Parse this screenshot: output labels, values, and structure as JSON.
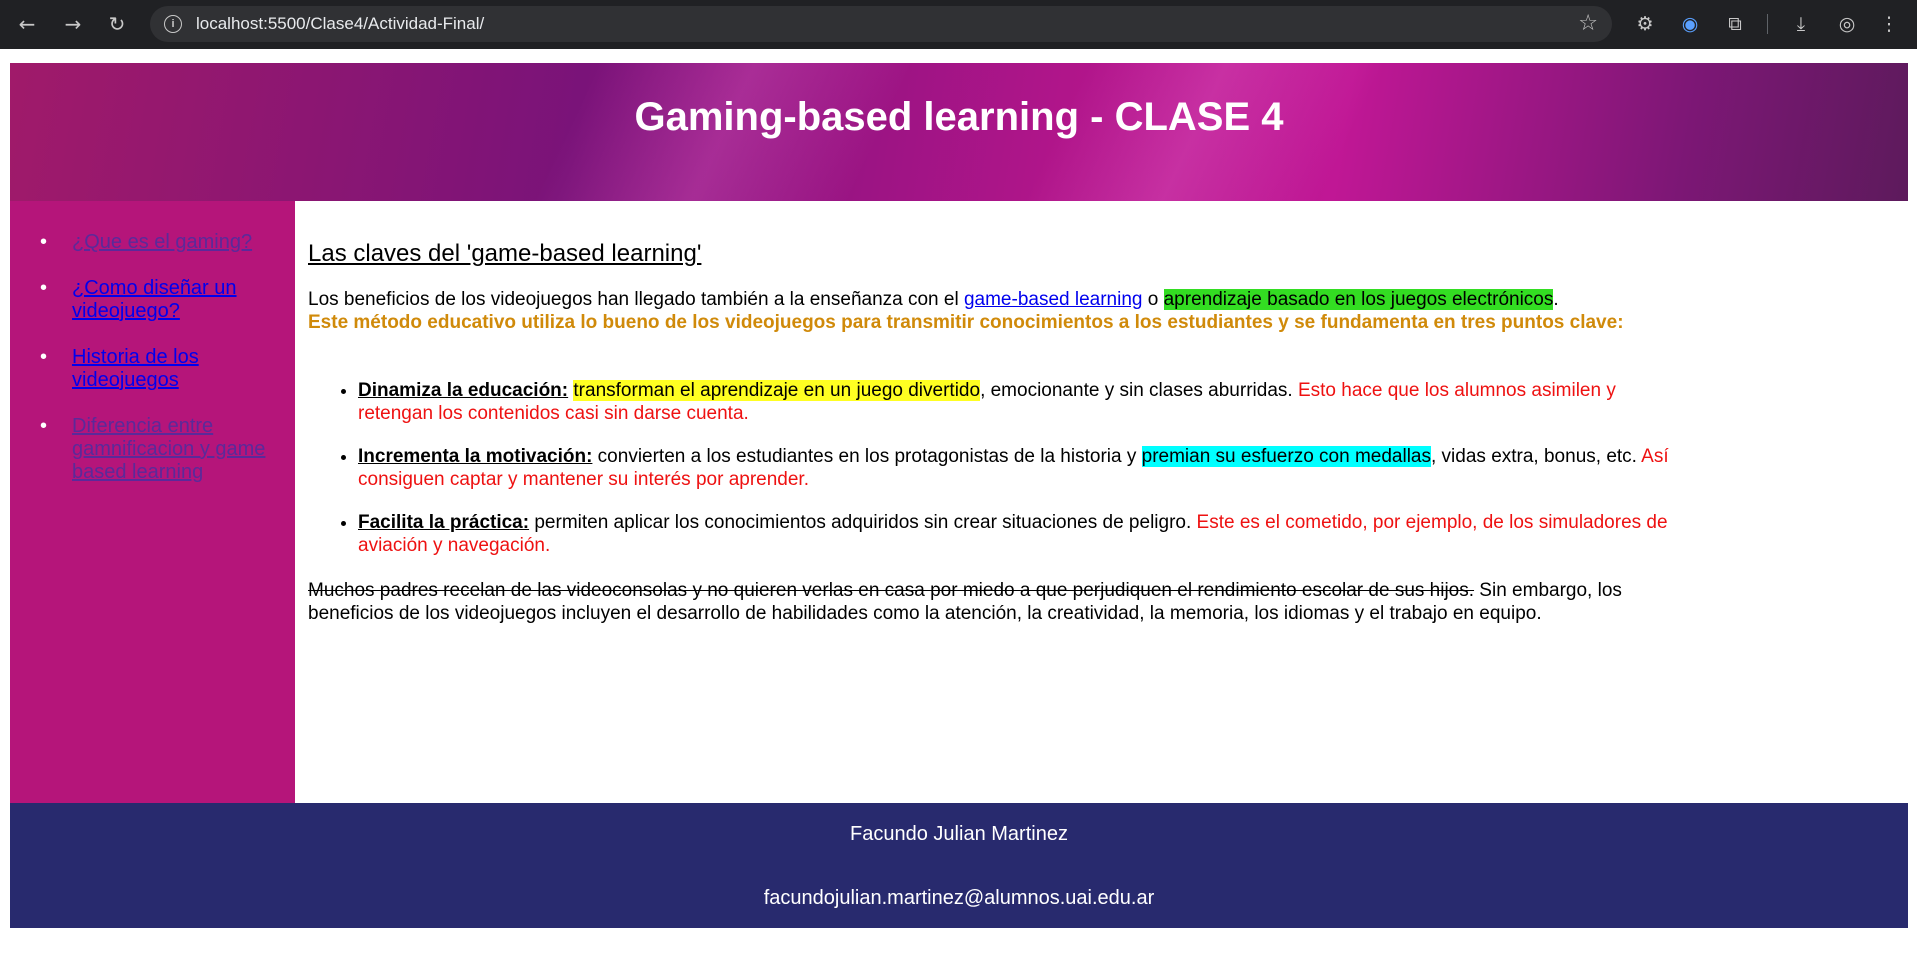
{
  "browser": {
    "url": "localhost:5500/Clase4/Actividad-Final/"
  },
  "header": {
    "title": "Gaming-based learning - CLASE 4"
  },
  "sidebar": {
    "items": [
      {
        "label": "¿Que es el gaming?"
      },
      {
        "label": "¿Como diseñar un videojuego?"
      },
      {
        "label": "Historia de los videojuegos"
      },
      {
        "label": "Diferencia entre gamnificacion y game based learning"
      }
    ]
  },
  "main": {
    "heading": "Las claves del 'game-based learning'",
    "intro": {
      "text1": "Los beneficios de los videojuegos han llegado también a la enseñanza con el ",
      "link": "game-based learning",
      "text2": " o ",
      "highlight": "aprendizaje basado en los juegos electrónicos",
      "text3": ".",
      "bold_orange": "Este método educativo utiliza lo bueno de los videojuegos para transmitir conocimientos a los estudiantes y se fundamenta en tres puntos clave:"
    },
    "points": [
      {
        "title": "Dinamiza la educación:",
        "highlight": "transforman el aprendizaje en un juego divertido",
        "text": ", emocionante y sin clases aburridas. ",
        "red": "Esto hace que los alumnos asimilen y retengan los contenidos casi sin darse cuenta."
      },
      {
        "title": "Incrementa la motivación:",
        "text_before": " convierten a los estudiantes en los protagonistas de la historia y ",
        "highlight": "premian su esfuerzo con medallas",
        "text": ", vidas extra, bonus, etc. ",
        "red": "Así consiguen captar y mantener su interés por aprender."
      },
      {
        "title": "Facilita la práctica:",
        "text": " permiten aplicar los conocimientos adquiridos sin crear situaciones de peligro. ",
        "red": "Este es el cometido, por ejemplo, de los simuladores de aviación y navegación."
      }
    ],
    "closing": {
      "strike": "Muchos padres recelan de las videoconsolas y no quieren verlas en casa por miedo a que perjudiquen el rendimiento escolar de sus hijos.",
      "text": " Sin embargo, los beneficios de los videojuegos incluyen el desarrollo de habilidades como la atención, la creatividad, la memoria, los idiomas y el trabajo en equipo."
    }
  },
  "footer": {
    "name": "Facundo Julian Martinez",
    "email": "facundojulian.martinez@alumnos.uai.edu.ar"
  },
  "colors": {
    "sidebar_bg": "#b5157a",
    "footer_bg": "#282a6e",
    "orange_text": "#d08a0a",
    "red_text": "#ee1111"
  }
}
